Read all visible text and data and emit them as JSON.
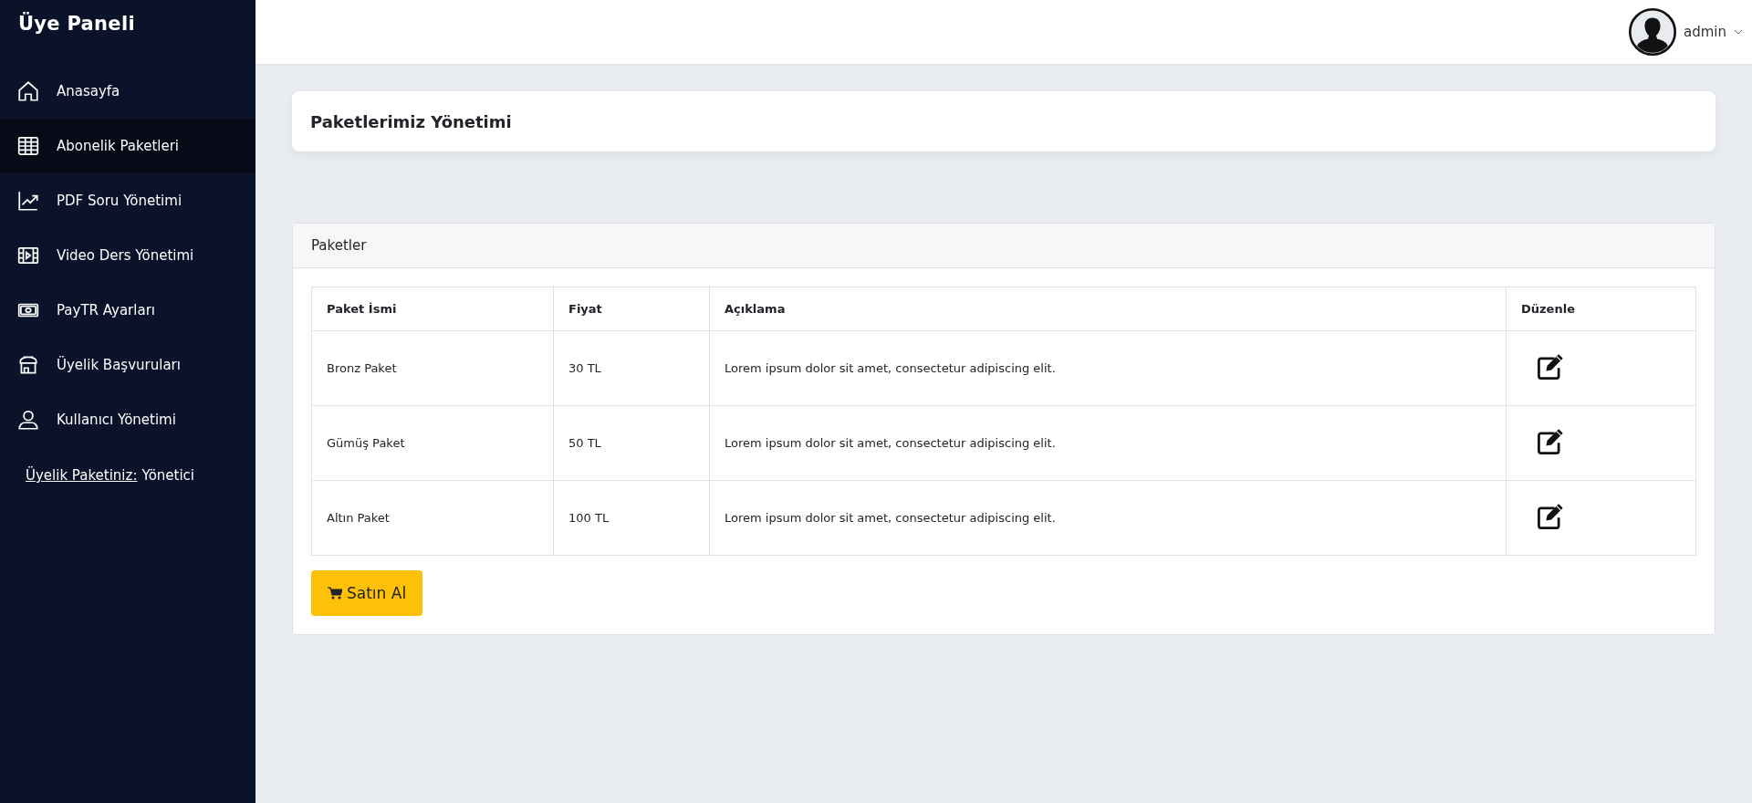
{
  "sidebar": {
    "title": "Üye Paneli",
    "items": [
      {
        "label": "Anasayfa",
        "selected": false
      },
      {
        "label": "Abonelik Paketleri",
        "selected": true
      },
      {
        "label": "PDF Soru Yönetimi",
        "selected": false
      },
      {
        "label": "Video Ders Yönetimi",
        "selected": false
      },
      {
        "label": "PayTR Ayarları",
        "selected": false
      },
      {
        "label": "Üyelik Başvuruları",
        "selected": false
      },
      {
        "label": "Kullanıcı Yönetimi",
        "selected": false
      }
    ],
    "membership": {
      "label": "Üyelik Paketiniz:",
      "value": "Yönetici"
    }
  },
  "topbar": {
    "user": "admin"
  },
  "page_title": "Paketlerimiz Yönetimi",
  "card": {
    "title": "Paketler",
    "table": {
      "columns": [
        "Paket İsmi",
        "Fiyat",
        "Açıklama",
        "Düzenle"
      ],
      "rows": [
        {
          "name": "Bronz Paket",
          "price": "30 TL",
          "description": "Lorem ipsum dolor sit amet, consectetur adipiscing elit."
        },
        {
          "name": "Gümüş Paket",
          "price": "50 TL",
          "description": "Lorem ipsum dolor sit amet, consectetur adipiscing elit."
        },
        {
          "name": "Altın Paket",
          "price": "100 TL",
          "description": "Lorem ipsum dolor sit amet, consectetur adipiscing elit."
        }
      ]
    },
    "buy_button": "Satın Al"
  }
}
